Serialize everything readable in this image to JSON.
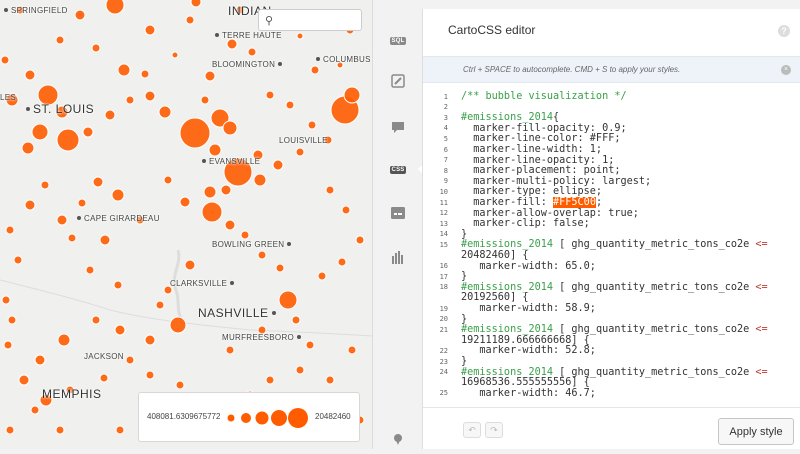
{
  "map": {
    "search": {
      "placeholder": ""
    },
    "cities": [
      {
        "name": "SPRINGFIELD",
        "big": false
      },
      {
        "name": "INDIAN",
        "big": true
      },
      {
        "name": "TERRE HAUTE",
        "big": false
      },
      {
        "name": "BLOOMINGTON",
        "big": false
      },
      {
        "name": "COLUMBUS",
        "big": false
      },
      {
        "name": "ST. LOUIS",
        "big": true
      },
      {
        "name": "LOUISVILLE",
        "big": false
      },
      {
        "name": "EVANSVILLE",
        "big": false
      },
      {
        "name": "CAPE GIRARDEAU",
        "big": false
      },
      {
        "name": "BOWLING GREEN",
        "big": false
      },
      {
        "name": "CLARKSVILLE",
        "big": false
      },
      {
        "name": "NASHVILLE",
        "big": true
      },
      {
        "name": "MURFREESBORO",
        "big": false
      },
      {
        "name": "JACKSON",
        "big": false
      },
      {
        "name": "MEMPHIS",
        "big": true
      },
      {
        "name": "LES",
        "big": false
      }
    ],
    "bubble_color": "#FF5C00",
    "legend": {
      "min": "408081.6309675772",
      "max": "20482460"
    }
  },
  "toolstrip": {
    "sql_label": "SQL",
    "css_label": "CSS",
    "icons": [
      "sql-icon",
      "wizard-brush-icon",
      "infowindow-icon",
      "css-icon",
      "legend-icon",
      "filter-chart-icon",
      "map-pin-icon"
    ]
  },
  "editor": {
    "title": "CartoCSS editor",
    "help_label": "?",
    "hint": "Ctrl + SPACE to autocomplete. CMD + S to apply your styles.",
    "close_label": "×",
    "undo_label": "↶",
    "redo_label": "↷",
    "apply_label": "Apply style",
    "lines": [
      {
        "n": "1",
        "text": "/** bubble visualization */"
      },
      {
        "n": "2",
        "text": ""
      },
      {
        "n": "3",
        "text": "#emissions_2014{"
      },
      {
        "n": "4",
        "text": "  marker-fill-opacity: 0.9;"
      },
      {
        "n": "5",
        "text": "  marker-line-color: #FFF;"
      },
      {
        "n": "6",
        "text": "  marker-line-width: 1;"
      },
      {
        "n": "7",
        "text": "  marker-line-opacity: 1;"
      },
      {
        "n": "8",
        "text": "  marker-placement: point;"
      },
      {
        "n": "9",
        "text": "  marker-multi-policy: largest;"
      },
      {
        "n": "10",
        "text": "  marker-type: ellipse;"
      },
      {
        "n": "11",
        "text": "  marker-fill: #FF5C00;"
      },
      {
        "n": "12",
        "text": "  marker-allow-overlap: true;"
      },
      {
        "n": "13",
        "text": "  marker-clip: false;"
      },
      {
        "n": "14",
        "text": "}"
      },
      {
        "n": "15",
        "text": "#emissions_2014 [ ghg_quantity_metric_tons_co2e <="
      },
      {
        "n": "",
        "text": "20482460] {"
      },
      {
        "n": "16",
        "text": "   marker-width: 65.0;"
      },
      {
        "n": "17",
        "text": "}"
      },
      {
        "n": "18",
        "text": "#emissions_2014 [ ghg_quantity_metric_tons_co2e <="
      },
      {
        "n": "",
        "text": "20192560] {"
      },
      {
        "n": "19",
        "text": "   marker-width: 58.9;"
      },
      {
        "n": "20",
        "text": "}"
      },
      {
        "n": "21",
        "text": "#emissions_2014 [ ghg_quantity_metric_tons_co2e <="
      },
      {
        "n": "",
        "text": "19211189.666666668] {"
      },
      {
        "n": "22",
        "text": "   marker-width: 52.8;"
      },
      {
        "n": "23",
        "text": "}"
      },
      {
        "n": "24",
        "text": "#emissions_2014 [ ghg_quantity_metric_tons_co2e <="
      },
      {
        "n": "",
        "text": "16968536.555555556] {"
      },
      {
        "n": "25",
        "text": "   marker-width: 46.7;"
      }
    ]
  }
}
